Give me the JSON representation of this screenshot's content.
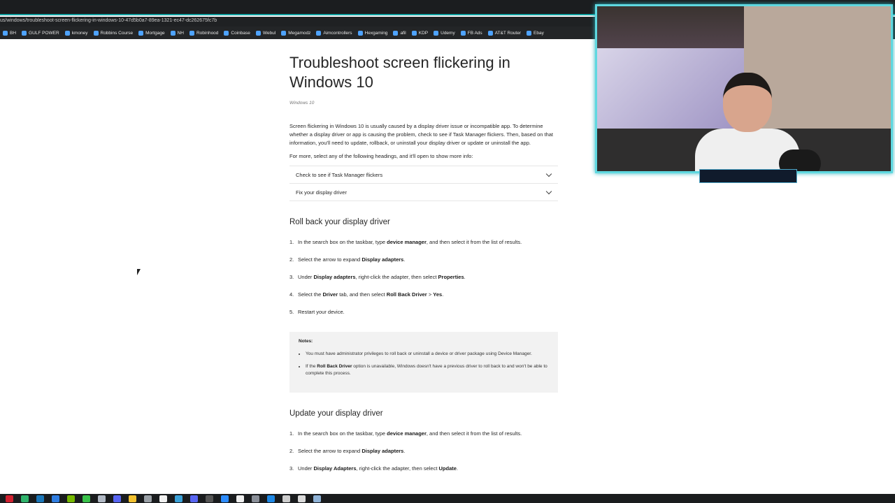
{
  "browser": {
    "url": "us/windows/troubleshoot-screen-flickering-in-windows-10-47d5b0a7-89ea-1321-ec47-dc262675fc7b",
    "bookmarks": [
      "BH",
      "GULF POWER",
      "kmoney",
      "Robbins Course",
      "Mortgage",
      "NH",
      "Robinhood",
      "Coinbase",
      "Webul",
      "Megamodz",
      "Aimcontrollers",
      "Hexgaming",
      "afil",
      "KDP",
      "Udemy",
      "FB Ads",
      "AT&T Router",
      "Ebay"
    ]
  },
  "article": {
    "title": "Troubleshoot screen flickering in Windows 10",
    "applies_to": "Windows 10",
    "intro": "Screen flickering in Windows 10 is usually caused by a display driver issue or incompatible app. To determine whether a display driver or app is causing the problem, check to see if Task Manager flickers. Then, based on that information, you'll need to update, rollback, or uninstall your display driver or update or uninstall the app.",
    "more_info": "For more, select any of the following headings, and it'll open to show more info:",
    "accordion": [
      {
        "label": "Check to see if Task Manager flickers"
      },
      {
        "label": "Fix your display driver"
      }
    ],
    "rollback_heading": "Roll back your display driver",
    "rollback_steps": {
      "s1": {
        "a": "In the search box on the taskbar, type ",
        "b": "device manager",
        "c": ", and then select it from the list of results."
      },
      "s2": {
        "a": "Select the arrow to expand ",
        "b": "Display adapters",
        "c": "."
      },
      "s3": {
        "a": "Under ",
        "b": "Display adapters",
        "c": ", right-click the adapter, then select ",
        "d": "Properties",
        "e": "."
      },
      "s4": {
        "a": "Select the ",
        "b": "Driver",
        "c": " tab, and then select ",
        "d": "Roll Back Driver",
        "e": " > ",
        "f": "Yes",
        "g": "."
      },
      "s5": {
        "a": "Restart your device."
      }
    },
    "notes": {
      "title": "Notes:",
      "n1": "You must have administrator privileges to roll back or uninstall a device or driver package using Device Manager.",
      "n2a": "If the ",
      "n2b": "Roll Back Driver",
      "n2c": " option is unavailable, Windows doesn't have a previous driver to roll back to and won't be able to complete this process."
    },
    "update_heading": "Update your display driver",
    "update_steps": {
      "s1": {
        "a": "In the search box on the taskbar, type ",
        "b": "device manager",
        "c": ", and then select it from the list of results."
      },
      "s2": {
        "a": "Select the arrow to expand ",
        "b": "Display adapters",
        "c": "."
      },
      "s3": {
        "a": "Under ",
        "b": "Display Adapters",
        "c": ", right-click the adapter, then select ",
        "d": "Update",
        "e": "."
      }
    }
  },
  "colors": {
    "accent": "#5fd8e0",
    "tab_strip_border": "#13a3a3"
  },
  "taskbar_icons": [
    "opera-icon",
    "app-green-icon",
    "steam-icon",
    "app-blue-icon",
    "nvidia-icon",
    "greenshot-icon",
    "app-icon",
    "discord-icon",
    "chrome-icon",
    "clock-icon",
    "terminal-icon",
    "app-icon",
    "discord-icon",
    "app-icon",
    "zoom-icon",
    "xbox-icon",
    "app-icon",
    "app-icon",
    "app-icon",
    "app-icon",
    "app-icon"
  ]
}
